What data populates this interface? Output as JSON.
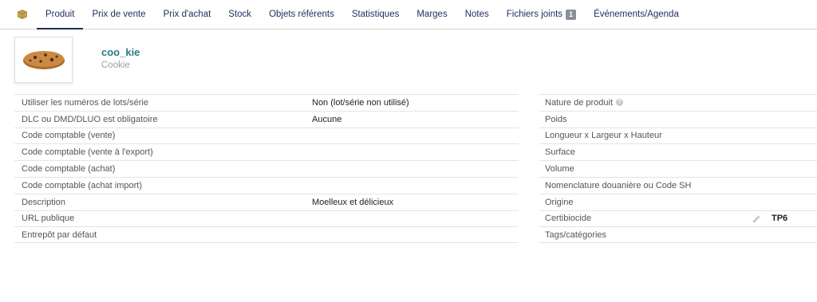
{
  "tabs": [
    {
      "label": "Produit"
    },
    {
      "label": "Prix de vente"
    },
    {
      "label": "Prix d'achat"
    },
    {
      "label": "Stock"
    },
    {
      "label": "Objets référents"
    },
    {
      "label": "Statistiques"
    },
    {
      "label": "Marges"
    },
    {
      "label": "Notes"
    },
    {
      "label": "Fichiers joints",
      "badge": "1"
    },
    {
      "label": "Événements/Agenda"
    }
  ],
  "product": {
    "ref": "coo_kie",
    "label": "Cookie"
  },
  "left_fields": [
    {
      "label": "Utiliser les numéros de lots/série",
      "value": "Non (lot/série non utilisé)"
    },
    {
      "label": "DLC ou DMD/DLUO est obligatoire",
      "value": "Aucune"
    },
    {
      "label": "Code comptable (vente)",
      "value": ""
    },
    {
      "label": "Code comptable (vente à l'export)",
      "value": ""
    },
    {
      "label": "Code comptable (achat)",
      "value": ""
    },
    {
      "label": "Code comptable (achat import)",
      "value": ""
    },
    {
      "label": "Description",
      "value": "Moelleux et délicieux"
    },
    {
      "label": "URL publique",
      "value": ""
    },
    {
      "label": "Entrepôt par défaut",
      "value": ""
    }
  ],
  "right_fields": [
    {
      "label": "Nature de produit",
      "value": ""
    },
    {
      "label": "Poids",
      "value": ""
    },
    {
      "label": "Longueur x Largeur x Hauteur",
      "value": ""
    },
    {
      "label": "Surface",
      "value": ""
    },
    {
      "label": "Volume",
      "value": ""
    },
    {
      "label": "Nomenclature douanière ou Code SH",
      "value": ""
    },
    {
      "label": "Origine",
      "value": ""
    },
    {
      "label": "Certibiocide",
      "value": "TP6"
    },
    {
      "label": "Tags/catégories",
      "value": ""
    }
  ],
  "colors": {
    "tab_text": "#1f2d5c",
    "ref_link": "#2a7a8c",
    "label_muted": "#a0a0a0",
    "row_border": "#e4e4e4"
  }
}
